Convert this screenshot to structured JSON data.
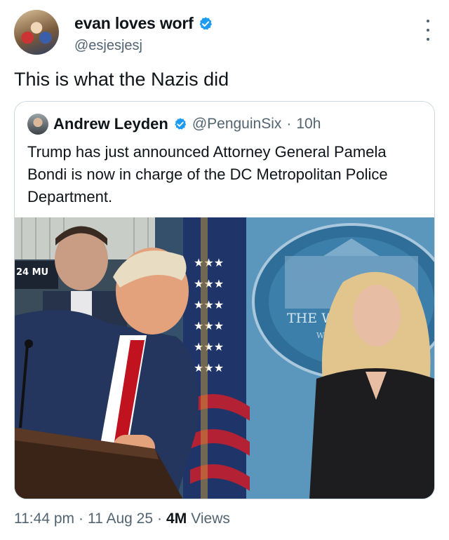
{
  "author": {
    "display_name": "evan loves worf",
    "handle": "@esjesjesj",
    "verified": true
  },
  "tweet": {
    "text": "This is what the Nazis did"
  },
  "quoted": {
    "display_name": "Andrew Leyden",
    "handle": "@PenguinSix",
    "separator": "·",
    "age": "10h",
    "text": "Trump has just announced Attorney General Pamela Bondi is now in charge of the DC Metropolitan Police Department.",
    "photo": {
      "screen_text": "24 MU",
      "seal_line1": "THE WHIT",
      "seal_line2": "WASHIN"
    }
  },
  "meta": {
    "time": "11:44 pm",
    "dot1": "·",
    "date": "11 Aug 25",
    "dot2": "·",
    "views_count": "4M",
    "views_label": "Views"
  },
  "colors": {
    "verified": "#1d9bf0",
    "secondary_text": "#536471",
    "border": "#cfd9de"
  },
  "icons": {
    "verified": "verified-badge-icon",
    "more": "more-options-icon"
  }
}
